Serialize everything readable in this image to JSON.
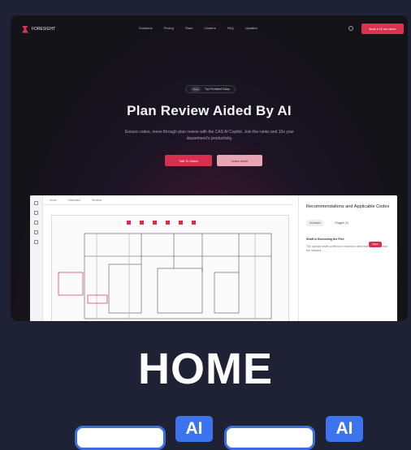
{
  "nav": {
    "brand": "FORESIGHT",
    "items": [
      "Solutions",
      "Pricing",
      "Team",
      "Careers",
      "FAQ",
      "Updates"
    ],
    "cta": "Book a 15 min demo"
  },
  "hero": {
    "pill_tag": "New",
    "pill_text": "Top Permitted Today",
    "title": "Plan Review Aided By AI",
    "subtitle": "Ensure codes, move through plan review with the CAS AI Copilot. Join the ranks and 10x your department's productivity.",
    "primary_button": "Talk To Sales",
    "secondary_button": "Learn More"
  },
  "app": {
    "tabs": [
      "Home",
      "Dashboard",
      "Reviews"
    ],
    "panel_title": "Recommendations and Applicable Codes",
    "panel_tabs": [
      "All issues",
      "Flagged (0)"
    ],
    "card_title": "Shaft is Exceeding the Flex",
    "card_badge": "Major",
    "card_text": "The spread shaft confirms a maximum area that is greater than the allowed..."
  },
  "section_heading": "HOME",
  "ai_badges": [
    "AI",
    "AI"
  ],
  "colors": {
    "accent": "#d8344f",
    "page_bg": "#1f2235",
    "ai_blue": "#3b74ee"
  }
}
